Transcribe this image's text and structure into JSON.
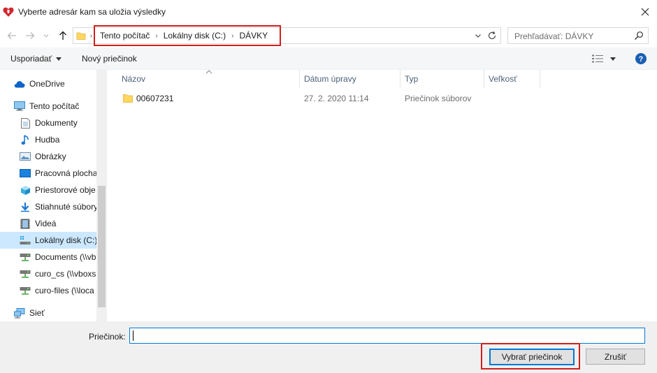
{
  "window": {
    "title": "Vyberte adresár kam sa uložia výsledky",
    "app_icon": "heart-logo-icon",
    "close_icon": "close-icon"
  },
  "navigation": {
    "back_icon": "arrow-left-icon",
    "forward_icon": "arrow-right-icon",
    "recent_icon": "chevron-down-icon",
    "up_icon": "arrow-up-icon"
  },
  "address": {
    "breadcrumbs": [
      "Tento počítač",
      "Lokálny disk (C:)",
      "DÁVKY"
    ],
    "highlight_color": "#d0201d"
  },
  "search": {
    "placeholder": "Prehľadávať: DÁVKY"
  },
  "toolbar": {
    "organize_label": "Usporiadať",
    "new_folder_label": "Nový priečinok"
  },
  "sidebar": {
    "items": [
      {
        "label": "OneDrive",
        "icon": "onedrive-cloud-icon"
      },
      {
        "label": "Tento počítač",
        "icon": "computer-icon"
      },
      {
        "label": "Dokumenty",
        "icon": "documents-icon"
      },
      {
        "label": "Hudba",
        "icon": "music-note-icon"
      },
      {
        "label": "Obrázky",
        "icon": "pictures-icon"
      },
      {
        "label": "Pracovná plocha",
        "icon": "desktop-icon"
      },
      {
        "label": "Priestorové obje",
        "icon": "3d-objects-icon"
      },
      {
        "label": "Stiahnuté súbory",
        "icon": "downloads-icon"
      },
      {
        "label": "Videá",
        "icon": "videos-icon"
      },
      {
        "label": "Lokálny disk (C:)",
        "icon": "local-disk-icon"
      },
      {
        "label": "Documents (\\\\vb",
        "icon": "network-drive-icon"
      },
      {
        "label": "curo_cs (\\\\vboxs",
        "icon": "network-drive-icon"
      },
      {
        "label": "curo-files (\\\\loca",
        "icon": "network-drive-icon"
      },
      {
        "label": "Sieť",
        "icon": "network-icon"
      }
    ],
    "selected_index": 9
  },
  "filelist": {
    "columns": [
      "Názov",
      "Dátum úpravy",
      "Typ",
      "Veľkosť"
    ],
    "rows": [
      {
        "name": "00607231",
        "date": "27. 2. 2020 11:14",
        "type": "Priečinok súborov",
        "size": ""
      }
    ]
  },
  "footer": {
    "folder_label": "Priečinok:",
    "folder_value": "",
    "select_label": "Vybrať priečinok",
    "cancel_label": "Zrušiť"
  },
  "colors": {
    "accent": "#0078d7",
    "selection": "#cce8ff",
    "highlight": "#d0201d",
    "help": "#1a5fb4"
  }
}
